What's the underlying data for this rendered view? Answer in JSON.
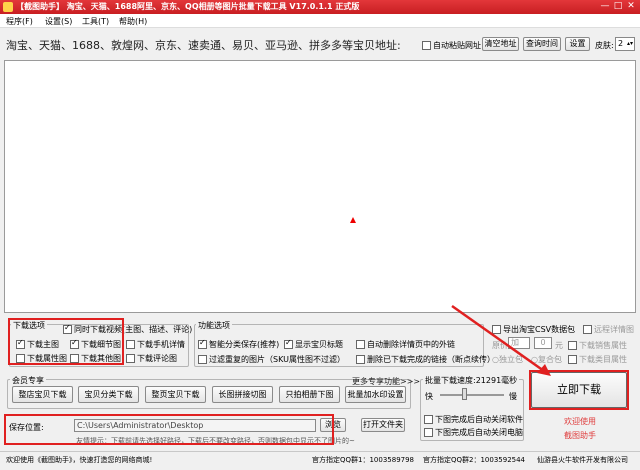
{
  "window": {
    "title": "【截图助手】 淘宝、天猫、1688阿里、京东、QQ相册等图片批量下载工具 V17.0.1.1 正式版",
    "min": "—",
    "max": "□",
    "close": "✕"
  },
  "menu": [
    "程序(F)",
    "设置(S)",
    "工具(T)",
    "帮助(H)"
  ],
  "top": {
    "address_label": "淘宝、天猫、1688、敦煌网、京东、速卖通、易贝、亚马逊、拼多多等宝贝地址:",
    "auto_paste": "自动粘贴网址",
    "clear_btn": "清空地址",
    "history_btn": "查询时间",
    "settings_btn": "设置",
    "skin_label": "皮肤:",
    "skin_value": "2"
  },
  "download_options": {
    "title": "下载选项",
    "items": [
      {
        "label": "同时下载视频(主图、描述、评论)",
        "checked": true
      },
      {
        "label": "下载主图",
        "checked": true
      },
      {
        "label": "下载细节图",
        "checked": true
      },
      {
        "label": "下载手机详情",
        "checked": false
      },
      {
        "label": "下载属性图",
        "checked": false
      },
      {
        "label": "下载其他图",
        "checked": false
      },
      {
        "label": "下载评论图",
        "checked": false
      }
    ]
  },
  "function_options": {
    "title": "功能选项",
    "items": [
      {
        "label": "智能分类保存(推荐)",
        "checked": true
      },
      {
        "label": "显示宝贝标题",
        "checked": true
      },
      {
        "label": "自动删除详情页中的外链",
        "checked": false
      },
      {
        "label": "过滤重复的图片（SKU属性图不过滤）",
        "checked": false
      },
      {
        "label": "删除已下载完成的链接（断点续传）",
        "checked": false
      }
    ]
  },
  "right_options": {
    "export_csv": "导出淘宝CSV数据包",
    "mode_label": "原价",
    "mode_value": "加",
    "price_value": "0",
    "price_unit": "元",
    "single": "独立包",
    "combined": "复合包",
    "note_detail": "远程详情图",
    "note_sales": "下载销售属性",
    "note_category": "下载类目属性"
  },
  "member": {
    "title": "会员专享",
    "more": "更多专享功能>>>",
    "buttons": [
      "整店宝贝下载",
      "宝贝分类下载",
      "整页宝贝下载",
      "长图拼接切图",
      "只拍相册下图",
      "批量加水印设置"
    ]
  },
  "speed": {
    "title": "批量下载速度:",
    "value": "21291",
    "unit": "毫秒",
    "fast": "快",
    "slow": "慢",
    "auto_close_software": "下图完成后自动关闭软件",
    "auto_close_pc": "下图完成后自动关闭电脑"
  },
  "download_btn": "立即下载",
  "welcome": [
    "欢迎使用",
    "截图助手"
  ],
  "save": {
    "label": "保存位置:",
    "path": "C:\\Users\\Administrator\\Desktop",
    "browse": "浏览",
    "open": "打开文件夹",
    "tip": "友情提示：下载前请先选择好路径，下载后不要改变路径，否则数据包中显示不了图片的~"
  },
  "status": {
    "welcome": "欢迎使用《截图助手》，快速打造您的网络商城!",
    "qq1": "官方指定QQ群1：1003589798",
    "qq2": "官方指定QQ群2：1003592544",
    "company": "仙游县火牛软件开发有限公司"
  },
  "colors": {
    "title_bar": "#d42a2e",
    "annotation_red": "#e02020",
    "welcome_text": "#e04040"
  }
}
